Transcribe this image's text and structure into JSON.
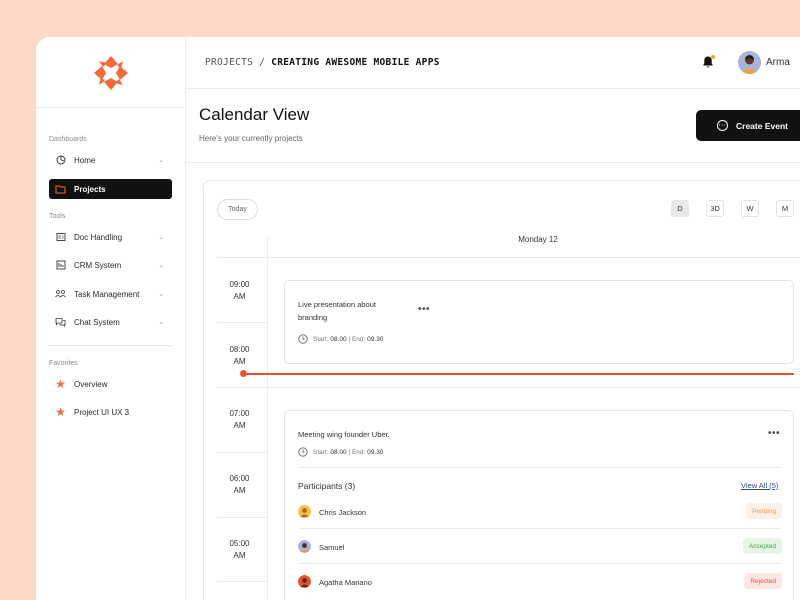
{
  "sidebar": {
    "sections": {
      "dashboards": "Dashboards",
      "tools": "Tools",
      "favorites": "Favorites"
    },
    "items": [
      {
        "label": "Home",
        "icon": "home-icon"
      },
      {
        "label": "Projects",
        "icon": "folder-icon",
        "active": true
      },
      {
        "label": "Doc Handling",
        "icon": "document-icon"
      },
      {
        "label": "CRM System",
        "icon": "crm-icon"
      },
      {
        "label": "Task Management",
        "icon": "tasks-icon"
      },
      {
        "label": "Chat System",
        "icon": "chat-icon"
      }
    ],
    "favorites": [
      {
        "label": "Overview",
        "icon": "star-icon"
      },
      {
        "label": "Project UI UX 3",
        "icon": "star-icon"
      }
    ]
  },
  "header": {
    "breadcrumb_parent": "PROJECTS",
    "breadcrumb_separator": "/",
    "breadcrumb_current": "CREATING AWESOME MOBILE APPS",
    "user_name": "Arma"
  },
  "page": {
    "title": "Calendar View",
    "subtitle": "Here's your currently projects",
    "create_button": "Create Event"
  },
  "calendar": {
    "today_label": "Today",
    "views": [
      "D",
      "3D",
      "W",
      "M"
    ],
    "active_view": "D",
    "day_label": "Monday 12",
    "times": [
      {
        "h": "09:00",
        "p": "AM"
      },
      {
        "h": "08:00",
        "p": "AM"
      },
      {
        "h": "07:00",
        "p": "AM"
      },
      {
        "h": "06:00",
        "p": "AM"
      },
      {
        "h": "05:00",
        "p": "AM"
      }
    ],
    "events": [
      {
        "title_line1": "Live presentation about",
        "title_line2": "branding",
        "start_label": "Start:",
        "start": "08.00",
        "separator": "|",
        "end_label": "End:",
        "end": "09.30"
      },
      {
        "title": "Meeting wing founder Uber.",
        "start_label": "Start:",
        "start": "08.00",
        "separator": "|",
        "end_label": "End:",
        "end": "09.30",
        "participants_title": "Participants (3)",
        "view_all": "View All (5)",
        "participants": [
          {
            "name": "Chris Jackson",
            "status": "Pending"
          },
          {
            "name": "Samuel",
            "status": "Accepted"
          },
          {
            "name": "Agatha Mariano",
            "status": "Rejected"
          }
        ]
      }
    ]
  },
  "colors": {
    "accent": "#e8532b",
    "logo": "#f26b3a",
    "background": "#fcd9c9",
    "pending_bg": "#fdf0e6",
    "pending_text": "#e59a62",
    "accepted_bg": "#e6f6e4",
    "accepted_text": "#4aa34a",
    "rejected_bg": "#fde6e4",
    "rejected_text": "#d9564b"
  }
}
